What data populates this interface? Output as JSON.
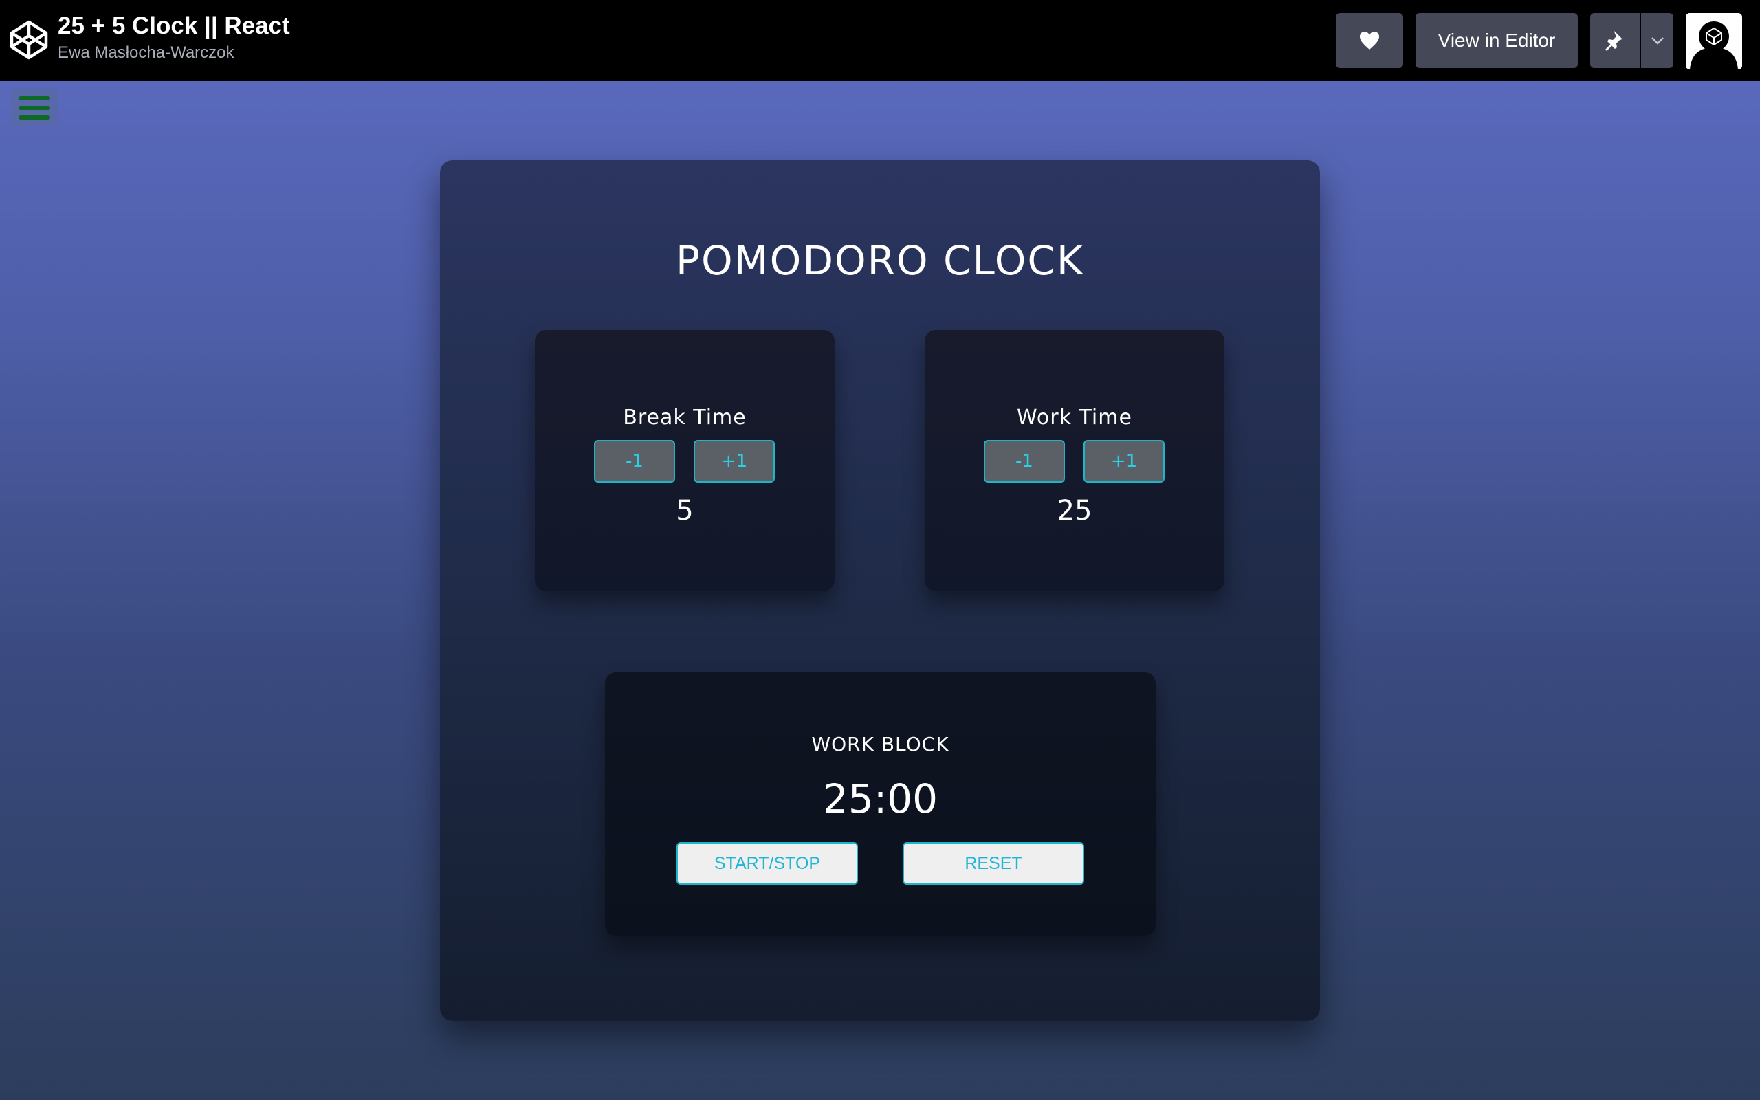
{
  "header": {
    "pen_title": "25 + 5 Clock || React",
    "author": "Ewa Masłocha-Warczok",
    "view_in_editor_label": "View in Editor",
    "logo_icon": "codepen-logo-icon",
    "heart_icon": "heart-icon",
    "pin_icon": "pin-icon",
    "caret_icon": "chevron-down-icon"
  },
  "menu": {
    "icon": "hamburger-menu-icon"
  },
  "clock": {
    "title": "POMODORO CLOCK",
    "break": {
      "label": "Break Time",
      "decrement_label": "-1",
      "increment_label": "+1",
      "value": "5"
    },
    "work": {
      "label": "Work Time",
      "decrement_label": "-1",
      "increment_label": "+1",
      "value": "25"
    },
    "timer": {
      "label": "WORK BLOCK",
      "display": "25:00",
      "start_stop_label": "START/STOP",
      "reset_label": "RESET"
    }
  },
  "colors": {
    "header_bg": "#000000",
    "header_button_bg": "#444857",
    "accent_cyan": "#1fb5c8",
    "hamburger_lines": "#0c6a24"
  }
}
